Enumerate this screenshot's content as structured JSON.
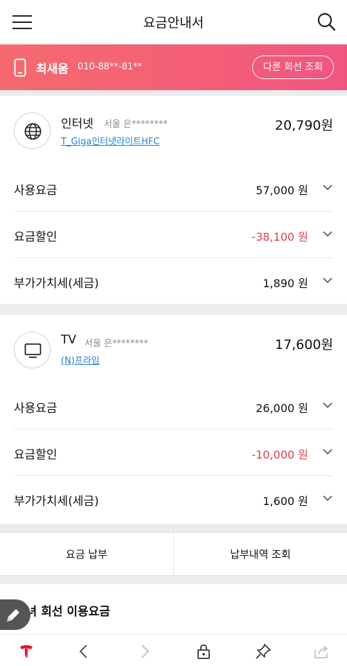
{
  "header": {
    "title": "요금안내서",
    "menu_icon": "hamburger-menu-icon",
    "search_icon": "search-icon"
  },
  "line": {
    "name": "최새움",
    "number": "010-88**-81**",
    "other_line_button": "다른 회선 조회",
    "icon": "smartphone-icon"
  },
  "internet": {
    "name": "인터넷",
    "region": "서울 은********",
    "plan": "T_Giga인터넷라이트HFC",
    "amount": "20,790원",
    "icon": "globe-icon",
    "rows": [
      {
        "label": "사용요금",
        "value": "57,000 원"
      },
      {
        "label": "요금할인",
        "value": "-38,100 원"
      },
      {
        "label": "부가가치세(세금)",
        "value": "1,890 원"
      }
    ]
  },
  "tv": {
    "name": "TV",
    "region": "서울 은********",
    "plan": "(N)프라임",
    "amount": "17,600원",
    "icon": "tv-icon",
    "rows": [
      {
        "label": "사용요금",
        "value": "26,000 원"
      },
      {
        "label": "요금할인",
        "value": "-10,000 원"
      },
      {
        "label": "부가가치세(세금)",
        "value": "1,600 원"
      }
    ]
  },
  "actions": {
    "pay": "요금 납부",
    "history": "납부내역 조회"
  },
  "family": {
    "title": "자녀 회선 이용요금"
  },
  "colors": {
    "accent_gradient_start": "#f56a6e",
    "accent_gradient_end": "#f0557f",
    "discount": "#e0424a",
    "link": "#1f7fd6"
  },
  "bottom_nav": [
    "t-logo-icon",
    "back-icon",
    "forward-icon",
    "lock-icon",
    "pin-icon",
    "share-icon"
  ]
}
